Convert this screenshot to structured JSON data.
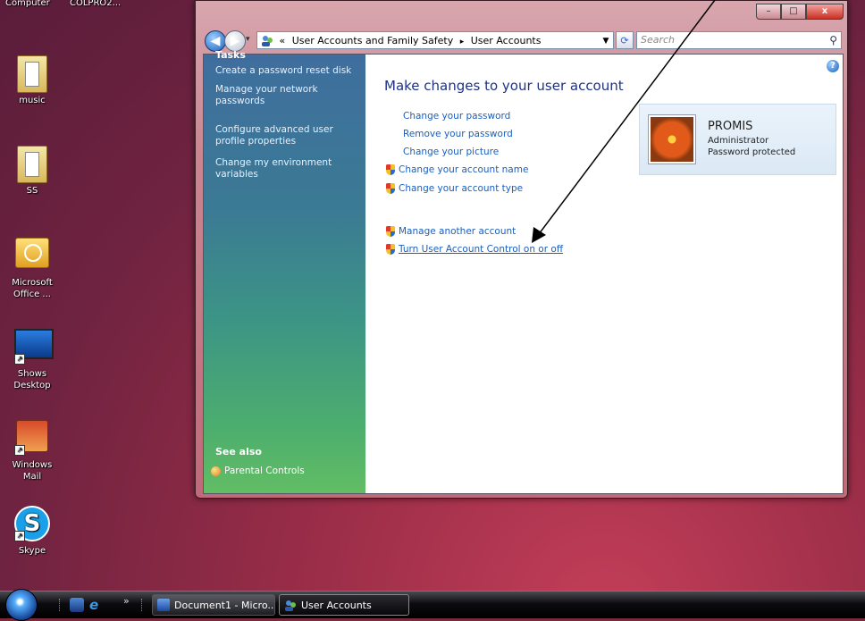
{
  "desktop": {
    "top_labels": [
      "Computer",
      "COLPRO2..."
    ],
    "icons": [
      {
        "label": "music"
      },
      {
        "label": "SS"
      },
      {
        "label": "Microsoft Office ..."
      },
      {
        "label": "Shows Desktop"
      },
      {
        "label": "Windows Mail"
      },
      {
        "label": "Skype"
      }
    ]
  },
  "window": {
    "controls": {
      "minimize": "–",
      "maximize": "□",
      "close": "x"
    },
    "address": {
      "overflow": "«",
      "crumbs": [
        "User Accounts and Family Safety",
        "User Accounts"
      ],
      "separator": "▸"
    },
    "search_placeholder": "Search",
    "sidebar": {
      "tasks_heading": "Tasks",
      "tasks": [
        "Create a password reset disk",
        "Manage your network passwords",
        "Configure advanced user profile properties",
        "Change my environment variables"
      ],
      "see_also_heading": "See also",
      "see_also": [
        "Parental Controls"
      ]
    },
    "main": {
      "title": "Make changes to your user account",
      "links": [
        "Change your password",
        "Remove your password",
        "Change your picture",
        "Change your account name",
        "Change your account type"
      ],
      "other_links": [
        "Manage another account",
        "Turn User Account Control on or off"
      ]
    },
    "user": {
      "name": "PROMIS",
      "role": "Administrator",
      "status": "Password protected"
    }
  },
  "taskbar": {
    "overflow": "»",
    "buttons": [
      {
        "label": "Document1 - Micro..."
      },
      {
        "label": "User Accounts"
      }
    ]
  },
  "colors": {
    "link": "#1a5fc0",
    "title": "#1e3287",
    "annotation_arrow": "#000000"
  }
}
